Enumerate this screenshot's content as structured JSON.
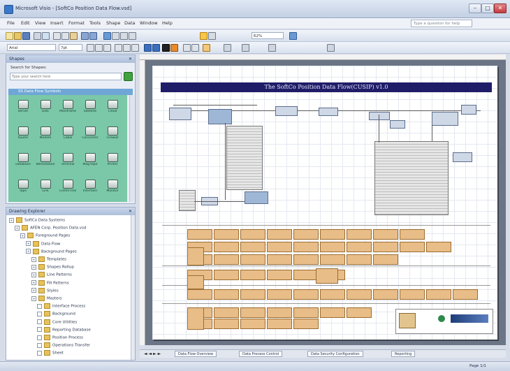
{
  "window": {
    "title": "Microsoft Visio - [SoftCo Position Data Flow.vsd]",
    "minimize": "–",
    "maximize": "□",
    "close": "✕"
  },
  "menubar": {
    "items": [
      "File",
      "Edit",
      "View",
      "Insert",
      "Format",
      "Tools",
      "Shape",
      "Data",
      "Window",
      "Help"
    ],
    "help_placeholder": "Type a question for help"
  },
  "toolbar": {
    "zoom": "62%",
    "font": "Arial",
    "size": "7pt"
  },
  "shapes_panel": {
    "title": "Shapes",
    "search_label": "Search for Shapes:",
    "search_placeholder": "Type your search here",
    "stencil_name": "SS Data Flow Symbols",
    "shapes": [
      "Server",
      "Disk",
      "Mainframe",
      "Satellite",
      "Cloud",
      "Router",
      "Modem",
      "Cable",
      "Connector",
      "Firewall",
      "Database",
      "Workstation",
      "Terminal",
      "Mag tape",
      "Printer",
      "Tape",
      "Link",
      "Comm-link",
      "Interface",
      "Monitor"
    ]
  },
  "drawing_explorer": {
    "title": "Drawing Explorer",
    "items": [
      {
        "label": "SoftCo Data Systems",
        "level": 0
      },
      {
        "label": "AFEN Corp. Position Data.vsd",
        "level": 1
      },
      {
        "label": "Foreground Pages",
        "level": 2
      },
      {
        "label": "Data Flow",
        "level": 3
      },
      {
        "label": "Background Pages",
        "level": 3
      },
      {
        "label": "Templates",
        "level": 4
      },
      {
        "label": "Shapes Rollup",
        "level": 4
      },
      {
        "label": "Line Patterns",
        "level": 4
      },
      {
        "label": "Fill Patterns",
        "level": 4
      },
      {
        "label": "Styles",
        "level": 4
      },
      {
        "label": "Masters",
        "level": 4
      },
      {
        "label": "Interface Process",
        "level": 5
      },
      {
        "label": "Background",
        "level": 5
      },
      {
        "label": "Core Utilities",
        "level": 5
      },
      {
        "label": "Reporting Database",
        "level": 5
      },
      {
        "label": "Position Process",
        "level": 5
      },
      {
        "label": "Operations Transfer",
        "level": 5
      },
      {
        "label": "Sheet",
        "level": 5
      }
    ]
  },
  "diagram": {
    "title": "The SoftCo Position Data Flow(CUSIP) v1.0"
  },
  "page_tabs": [
    "Data Flow Overview",
    "Data Process Control",
    "Data Security Configuration",
    "Reporting"
  ],
  "statusbar": {
    "page_indicator": "Page 1/1"
  }
}
